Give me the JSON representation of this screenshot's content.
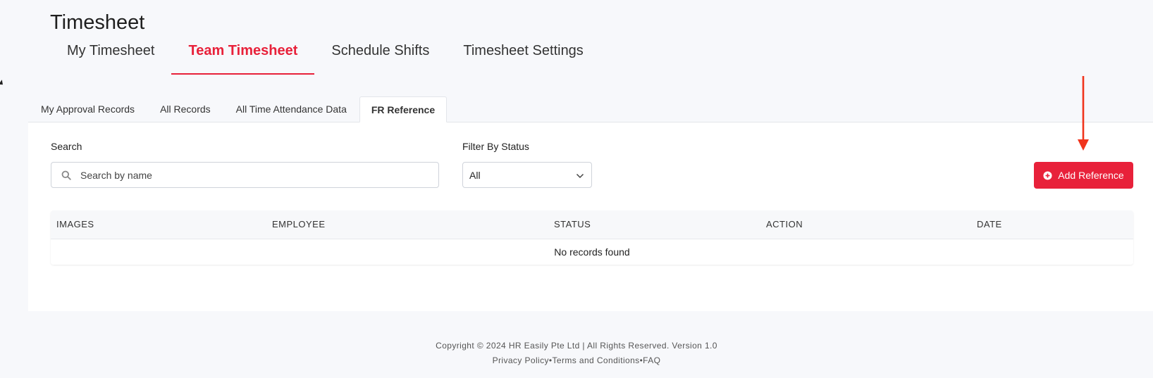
{
  "page": {
    "title": "Timesheet"
  },
  "main_tabs": [
    {
      "label": "My Timesheet",
      "active": false
    },
    {
      "label": "Team Timesheet",
      "active": true
    },
    {
      "label": "Schedule Shifts",
      "active": false
    },
    {
      "label": "Timesheet Settings",
      "active": false
    }
  ],
  "sub_tabs": [
    {
      "label": "My Approval Records",
      "active": false
    },
    {
      "label": "All Records",
      "active": false
    },
    {
      "label": "All Time Attendance Data",
      "active": false
    },
    {
      "label": "FR Reference",
      "active": true
    }
  ],
  "filters": {
    "search_label": "Search",
    "search_placeholder": "Search by name",
    "search_value": "",
    "status_label": "Filter By Status",
    "status_value": "All"
  },
  "actions": {
    "add_reference_label": "Add Reference"
  },
  "table": {
    "columns": [
      "IMAGES",
      "EMPLOYEE",
      "STATUS",
      "ACTION",
      "DATE"
    ],
    "empty_text": "No records found"
  },
  "footer": {
    "copyright": "Copyright © 2024 HR Easily Pte Ltd | All Rights Reserved. Version 1.0",
    "privacy": "Privacy Policy",
    "separator": "•",
    "terms": "Terms and Conditions",
    "faq": "FAQ"
  },
  "colors": {
    "accent": "#e8213a",
    "annotation_arrow": "#f0341c"
  },
  "icons": {
    "search": "search-icon",
    "dropdown": "chevron-down-icon",
    "add": "plus-circle-icon"
  }
}
